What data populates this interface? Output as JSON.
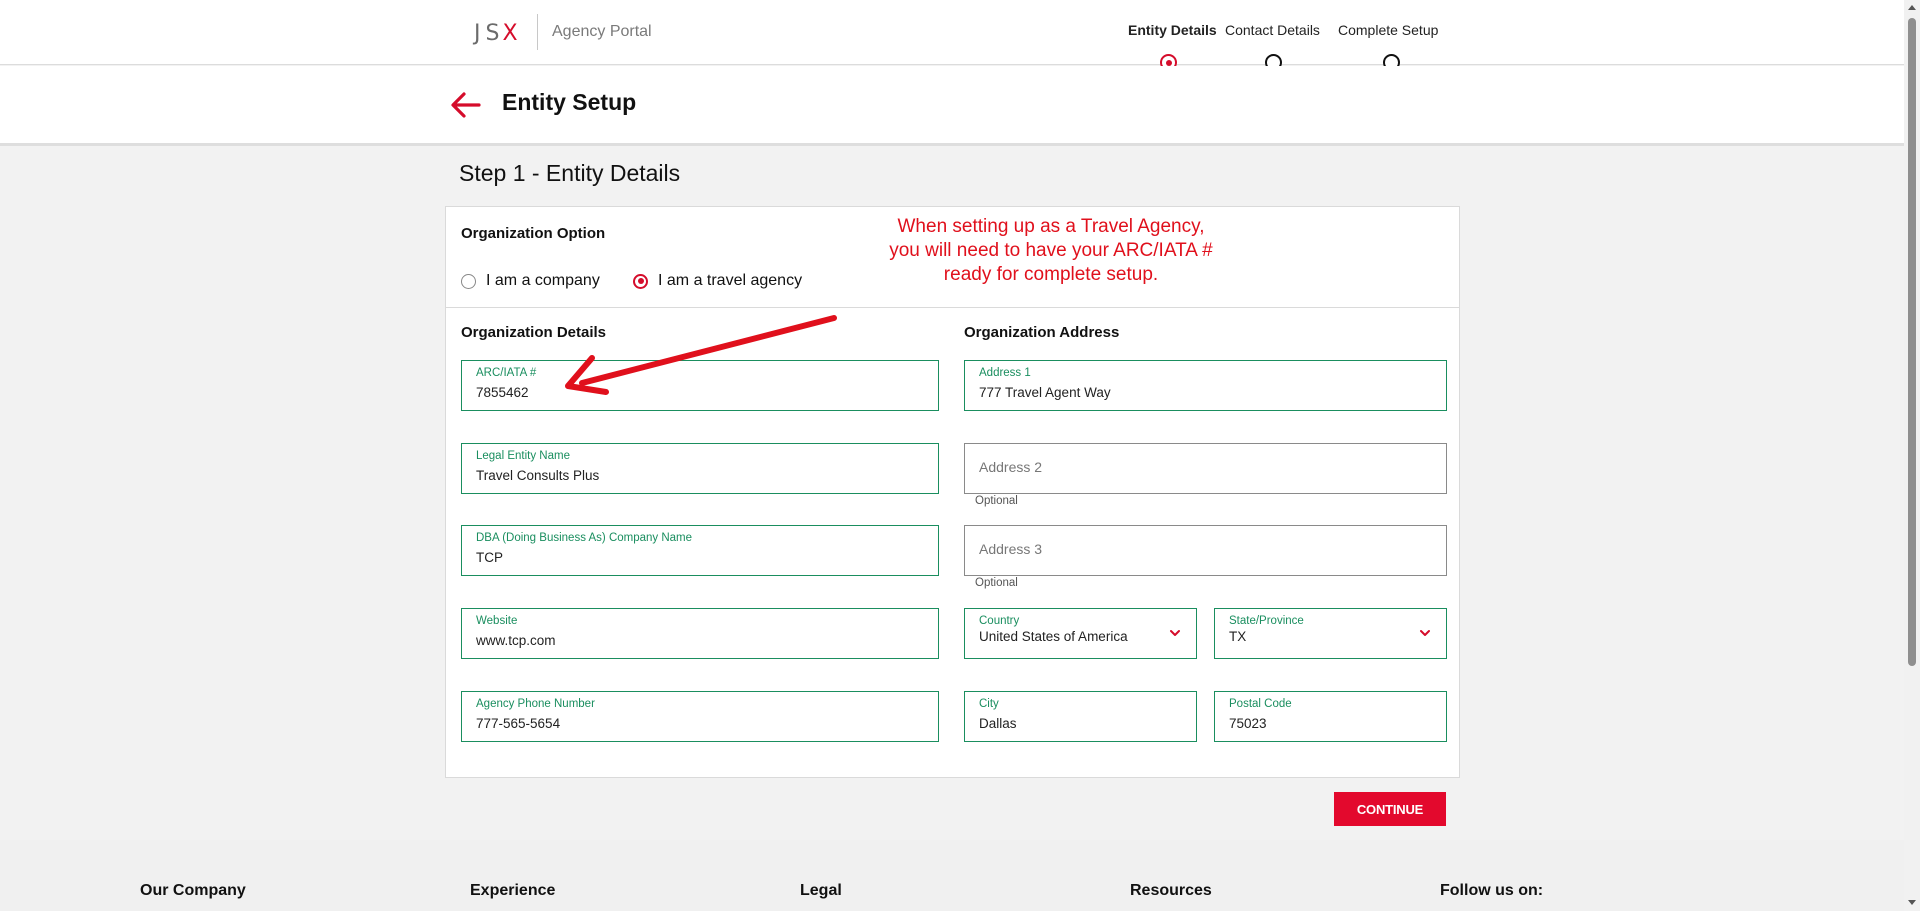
{
  "header": {
    "logo_text": "JS",
    "logo_x": "X",
    "portal_name": "Agency Portal",
    "steps": [
      {
        "label": "Entity Details",
        "active": true
      },
      {
        "label": "Contact Details",
        "active": false
      },
      {
        "label": "Complete Setup",
        "active": false
      }
    ]
  },
  "title_bar": {
    "title": "Entity Setup",
    "back_icon": "arrow-left-icon"
  },
  "main": {
    "step_heading": "Step 1 - Entity Details",
    "organization_option": {
      "title": "Organization Option",
      "options": [
        {
          "label": "I am a company",
          "selected": false
        },
        {
          "label": "I am a travel agency",
          "selected": true
        }
      ]
    },
    "annotation_text": {
      "line1": "When setting up as a Travel Agency,",
      "line2": "you will need to have your ARC/IATA #",
      "line3": "ready for complete setup."
    },
    "organization_details": {
      "title": "Organization Details",
      "arc_iata": {
        "label": "ARC/IATA #",
        "value": "7855462"
      },
      "legal_entity_name": {
        "label": "Legal Entity Name",
        "value": "Travel Consults Plus"
      },
      "dba_name": {
        "label": "DBA (Doing Business As) Company Name",
        "value": "TCP"
      },
      "website": {
        "label": "Website",
        "value": "www.tcp.com"
      },
      "agency_phone": {
        "label": "Agency Phone Number",
        "value": "777-565-5654"
      }
    },
    "organization_address": {
      "title": "Organization Address",
      "address1": {
        "label": "Address 1",
        "value": "777 Travel Agent Way"
      },
      "address2": {
        "placeholder": "Address 2",
        "hint": "Optional"
      },
      "address3": {
        "placeholder": "Address 3",
        "hint": "Optional"
      },
      "country": {
        "label": "Country",
        "value": "United States of America"
      },
      "state": {
        "label": "State/Province",
        "value": "TX"
      },
      "city": {
        "label": "City",
        "value": "Dallas"
      },
      "postal_code": {
        "label": "Postal Code",
        "value": "75023"
      }
    },
    "continue_label": "CONTINUE"
  },
  "footer": {
    "columns": [
      "Our Company",
      "Experience",
      "Legal",
      "Resources",
      "Follow us on:"
    ]
  },
  "colors": {
    "brand_red": "#d50c2b",
    "field_green": "#1a8e5f",
    "annotation_red": "#e0101c"
  }
}
